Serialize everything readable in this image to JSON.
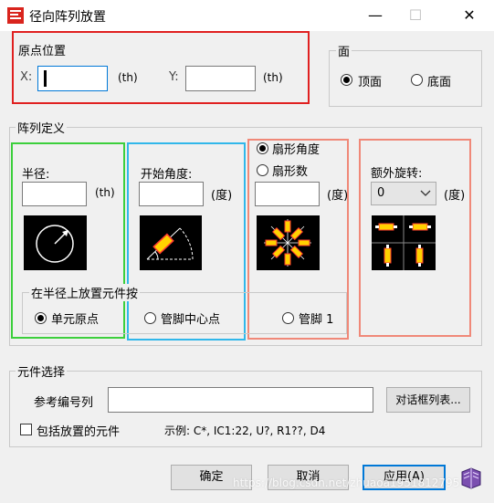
{
  "window": {
    "title": "径向阵列放置",
    "minimize_glyph": "—",
    "maximize_glyph": "☐",
    "close_glyph": "✕"
  },
  "origin": {
    "group_label": "原点位置",
    "x_label": "X:",
    "x_value": "",
    "x_unit": "(th)",
    "y_label": "Y:",
    "y_value": "",
    "y_unit": "(th)"
  },
  "face": {
    "group_label": "面",
    "top_label": "顶面",
    "bottom_label": "底面",
    "selected": "top"
  },
  "array_def": {
    "group_label": "阵列定义",
    "radius": {
      "label": "半径:",
      "value": "",
      "unit": "(th)"
    },
    "start_angle": {
      "label": "开始角度:",
      "value": "",
      "unit": "(度)"
    },
    "sector": {
      "angle_label": "扇形角度",
      "count_label": "扇形数",
      "selected": "angle",
      "value": "",
      "unit": "(度)"
    },
    "rotation": {
      "label": "额外旋转:",
      "value": "0",
      "unit": "(度)"
    },
    "place_on_radius": {
      "label": "在半径上放置元件按",
      "option1": "单元原点",
      "option2": "管脚中心点",
      "option3": "管脚 1",
      "selected": "option1"
    }
  },
  "component": {
    "group_label": "元件选择",
    "refdes_label": "参考编号列",
    "refdes_value": "",
    "dialog_list_button": "对话框列表...",
    "include_placed_label": "包括放置的元件",
    "include_placed_checked": false,
    "example_text": "示例: C*, IC1:22, U?, R1??, D4"
  },
  "buttons": {
    "ok": "确定",
    "cancel": "取消",
    "apply": "应用(A)"
  },
  "watermark": "https://blog.csdn.net/zhuaoa1951812795",
  "icons": {
    "app": "pcb-app-icon",
    "help": "help-book-icon"
  }
}
